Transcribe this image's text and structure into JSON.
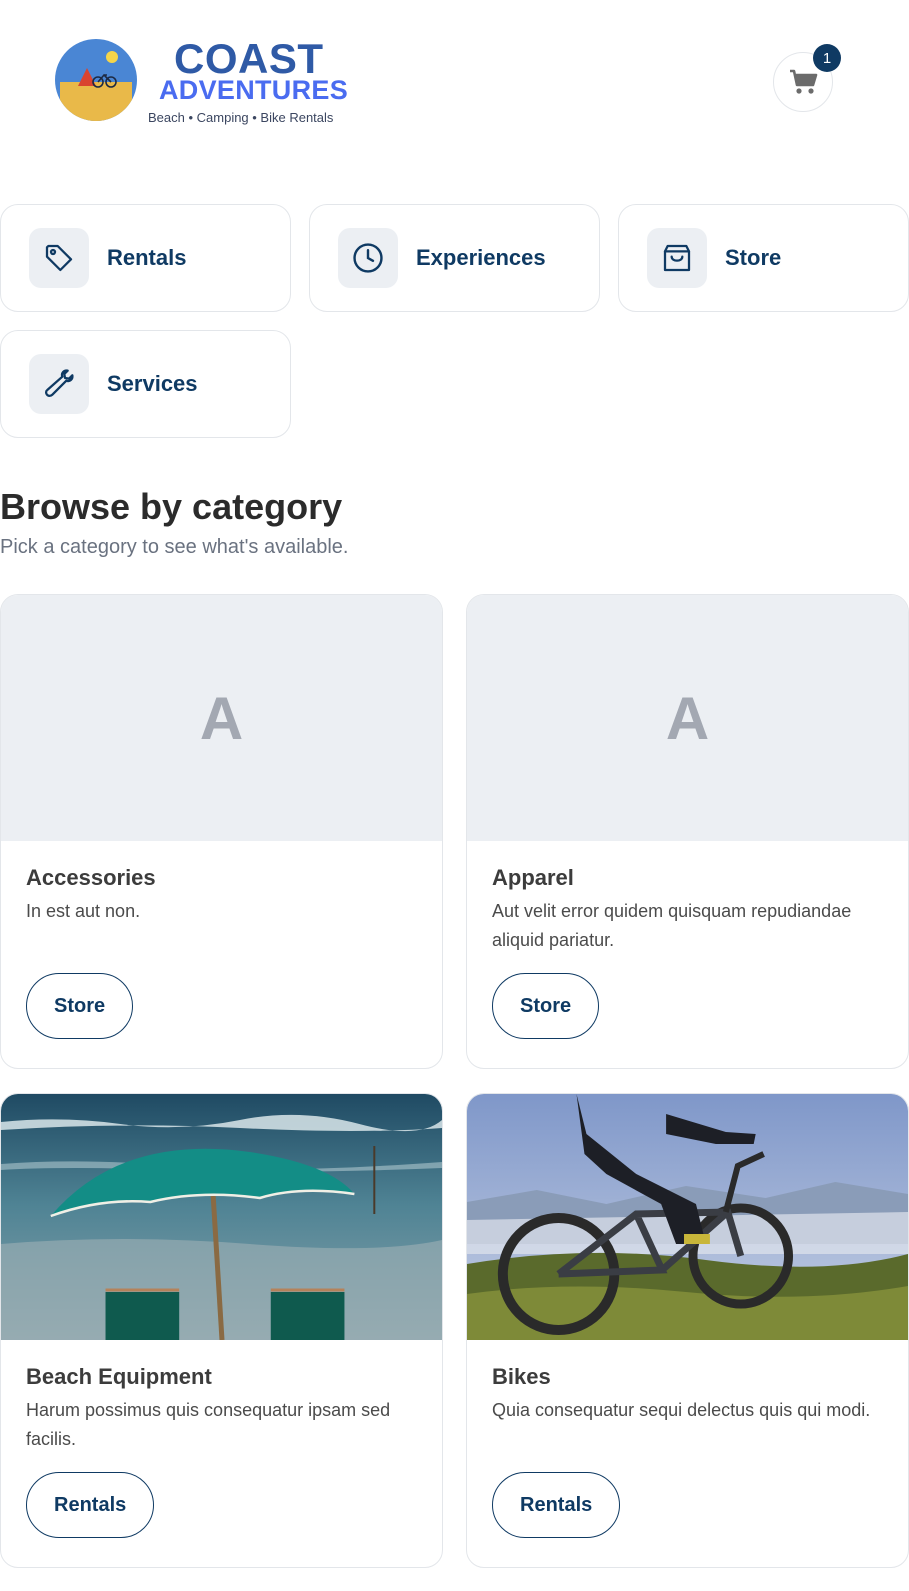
{
  "brand": {
    "name_line1": "COAST",
    "name_line2": "ADVENTURES",
    "tagline": "Beach • Camping • Bike Rentals"
  },
  "cart": {
    "icon": "cart-icon",
    "count": "1"
  },
  "nav": {
    "tiles": [
      {
        "label": "Rentals",
        "icon": "tag-icon"
      },
      {
        "label": "Experiences",
        "icon": "clock-icon"
      },
      {
        "label": "Store",
        "icon": "shopping-bag-icon"
      },
      {
        "label": "Services",
        "icon": "wrench-icon"
      }
    ]
  },
  "browse": {
    "title": "Browse by category",
    "subtitle": "Pick a category to see what's available."
  },
  "categories": [
    {
      "name": "Accessories",
      "placeholder": "A",
      "description": "In est aut non.",
      "button": "Store"
    },
    {
      "name": "Apparel",
      "placeholder": "A",
      "description": "Aut velit error quidem quisquam repudiandae aliquid pariatur.",
      "button": "Store"
    },
    {
      "name": "Beach Equipment",
      "image": "beach-umbrella-photo",
      "description": "Harum possimus quis consequatur ipsam sed facilis.",
      "button": "Rentals"
    },
    {
      "name": "Bikes",
      "image": "mountain-bike-photo",
      "description": "Quia consequatur sequi delectus quis qui modi.",
      "button": "Rentals"
    }
  ],
  "colors": {
    "primary": "#0f3a63",
    "brand_blue": "#2f5aa6",
    "brand_accent": "#4a6cf0",
    "tile_bg": "#eceff3",
    "border": "#e3e6ea"
  }
}
